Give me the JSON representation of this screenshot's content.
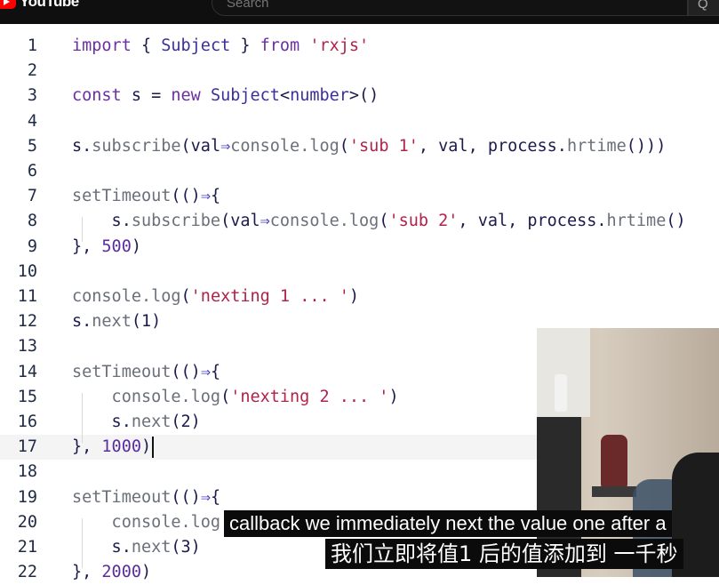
{
  "header": {
    "logo_text": "YouTube",
    "search_placeholder": "Search",
    "search_button_label": "Q"
  },
  "editor": {
    "line_numbers": [
      "1",
      "2",
      "3",
      "4",
      "5",
      "6",
      "7",
      "8",
      "9",
      "10",
      "11",
      "12",
      "13",
      "14",
      "15",
      "16",
      "17",
      "18",
      "19",
      "20",
      "21",
      "22"
    ],
    "lines": [
      {
        "n": "1",
        "tokens": [
          {
            "t": "import",
            "c": "kw"
          },
          {
            "t": " { ",
            "c": "pl"
          },
          {
            "t": "Subject",
            "c": "ty"
          },
          {
            "t": " } ",
            "c": "pl"
          },
          {
            "t": "from",
            "c": "kw"
          },
          {
            "t": " ",
            "c": "pl"
          },
          {
            "t": "'rxjs'",
            "c": "st"
          }
        ]
      },
      {
        "n": "2",
        "tokens": []
      },
      {
        "n": "3",
        "tokens": [
          {
            "t": "const",
            "c": "kw"
          },
          {
            "t": " s = ",
            "c": "pl"
          },
          {
            "t": "new",
            "c": "kw"
          },
          {
            "t": " ",
            "c": "pl"
          },
          {
            "t": "Subject",
            "c": "ty"
          },
          {
            "t": "<",
            "c": "pl"
          },
          {
            "t": "number",
            "c": "ty"
          },
          {
            "t": ">()",
            "c": "pl"
          }
        ]
      },
      {
        "n": "4",
        "tokens": []
      },
      {
        "n": "5",
        "tokens": [
          {
            "t": "s.",
            "c": "pl"
          },
          {
            "t": "subscribe",
            "c": "fn"
          },
          {
            "t": "(val",
            "c": "pl"
          },
          {
            "t": "⇒",
            "c": "op"
          },
          {
            "t": "console.",
            "c": "fn"
          },
          {
            "t": "log",
            "c": "fn"
          },
          {
            "t": "(",
            "c": "pl"
          },
          {
            "t": "'sub 1'",
            "c": "st"
          },
          {
            "t": ", val, process.",
            "c": "pl"
          },
          {
            "t": "hrtime",
            "c": "fn"
          },
          {
            "t": "()))",
            "c": "pl"
          }
        ]
      },
      {
        "n": "6",
        "tokens": []
      },
      {
        "n": "7",
        "tokens": [
          {
            "t": "setTimeout",
            "c": "fn"
          },
          {
            "t": "(()",
            "c": "pl"
          },
          {
            "t": "⇒",
            "c": "op"
          },
          {
            "t": "{",
            "c": "pl"
          }
        ]
      },
      {
        "n": "8",
        "tokens": [
          {
            "t": "    s.",
            "c": "pl"
          },
          {
            "t": "subscribe",
            "c": "fn"
          },
          {
            "t": "(val",
            "c": "pl"
          },
          {
            "t": "⇒",
            "c": "op"
          },
          {
            "t": "console.",
            "c": "fn"
          },
          {
            "t": "log",
            "c": "fn"
          },
          {
            "t": "(",
            "c": "pl"
          },
          {
            "t": "'sub 2'",
            "c": "st"
          },
          {
            "t": ", val, process.",
            "c": "pl"
          },
          {
            "t": "hrtime",
            "c": "fn"
          },
          {
            "t": "()",
            "c": "pl"
          }
        ]
      },
      {
        "n": "9",
        "tokens": [
          {
            "t": "}, ",
            "c": "pl"
          },
          {
            "t": "500",
            "c": "nu"
          },
          {
            "t": ")",
            "c": "pl"
          }
        ]
      },
      {
        "n": "10",
        "tokens": []
      },
      {
        "n": "11",
        "tokens": [
          {
            "t": "console.",
            "c": "fn"
          },
          {
            "t": "log",
            "c": "fn"
          },
          {
            "t": "(",
            "c": "pl"
          },
          {
            "t": "'nexting 1 ... '",
            "c": "st"
          },
          {
            "t": ")",
            "c": "pl"
          }
        ]
      },
      {
        "n": "12",
        "tokens": [
          {
            "t": "s.",
            "c": "pl"
          },
          {
            "t": "next",
            "c": "fn"
          },
          {
            "t": "(1)",
            "c": "pl"
          }
        ]
      },
      {
        "n": "13",
        "tokens": []
      },
      {
        "n": "14",
        "tokens": [
          {
            "t": "setTimeout",
            "c": "fn"
          },
          {
            "t": "(()",
            "c": "pl"
          },
          {
            "t": "⇒",
            "c": "op"
          },
          {
            "t": "{",
            "c": "pl"
          }
        ]
      },
      {
        "n": "15",
        "tokens": [
          {
            "t": "    console.",
            "c": "fn"
          },
          {
            "t": "log",
            "c": "fn"
          },
          {
            "t": "(",
            "c": "pl"
          },
          {
            "t": "'nexting 2 ... '",
            "c": "st"
          },
          {
            "t": ")",
            "c": "pl"
          }
        ]
      },
      {
        "n": "16",
        "tokens": [
          {
            "t": "    s.",
            "c": "pl"
          },
          {
            "t": "next",
            "c": "fn"
          },
          {
            "t": "(2)",
            "c": "pl"
          }
        ]
      },
      {
        "n": "17",
        "tokens": [
          {
            "t": "}, ",
            "c": "pl"
          },
          {
            "t": "1000",
            "c": "nu"
          },
          {
            "t": ")",
            "c": "pl"
          }
        ]
      },
      {
        "n": "18",
        "tokens": []
      },
      {
        "n": "19",
        "tokens": [
          {
            "t": "setTimeout",
            "c": "fn"
          },
          {
            "t": "(()",
            "c": "pl"
          },
          {
            "t": "⇒",
            "c": "op"
          },
          {
            "t": "{",
            "c": "pl"
          }
        ]
      },
      {
        "n": "20",
        "tokens": [
          {
            "t": "    console.",
            "c": "fn"
          },
          {
            "t": "log",
            "c": "fn"
          },
          {
            "t": "(",
            "c": "pl"
          }
        ]
      },
      {
        "n": "21",
        "tokens": [
          {
            "t": "    s.",
            "c": "pl"
          },
          {
            "t": "next",
            "c": "fn"
          },
          {
            "t": "(3)",
            "c": "pl"
          }
        ]
      },
      {
        "n": "22",
        "tokens": [
          {
            "t": "}, ",
            "c": "pl"
          },
          {
            "t": "2000",
            "c": "nu"
          },
          {
            "t": ")",
            "c": "pl"
          }
        ]
      }
    ]
  },
  "captions": {
    "english": "callback we immediately next the value one after a",
    "chinese": "我们立即将值1 后的值添加到 一千秒"
  },
  "webcam": {
    "label": "webcam-overlay"
  }
}
